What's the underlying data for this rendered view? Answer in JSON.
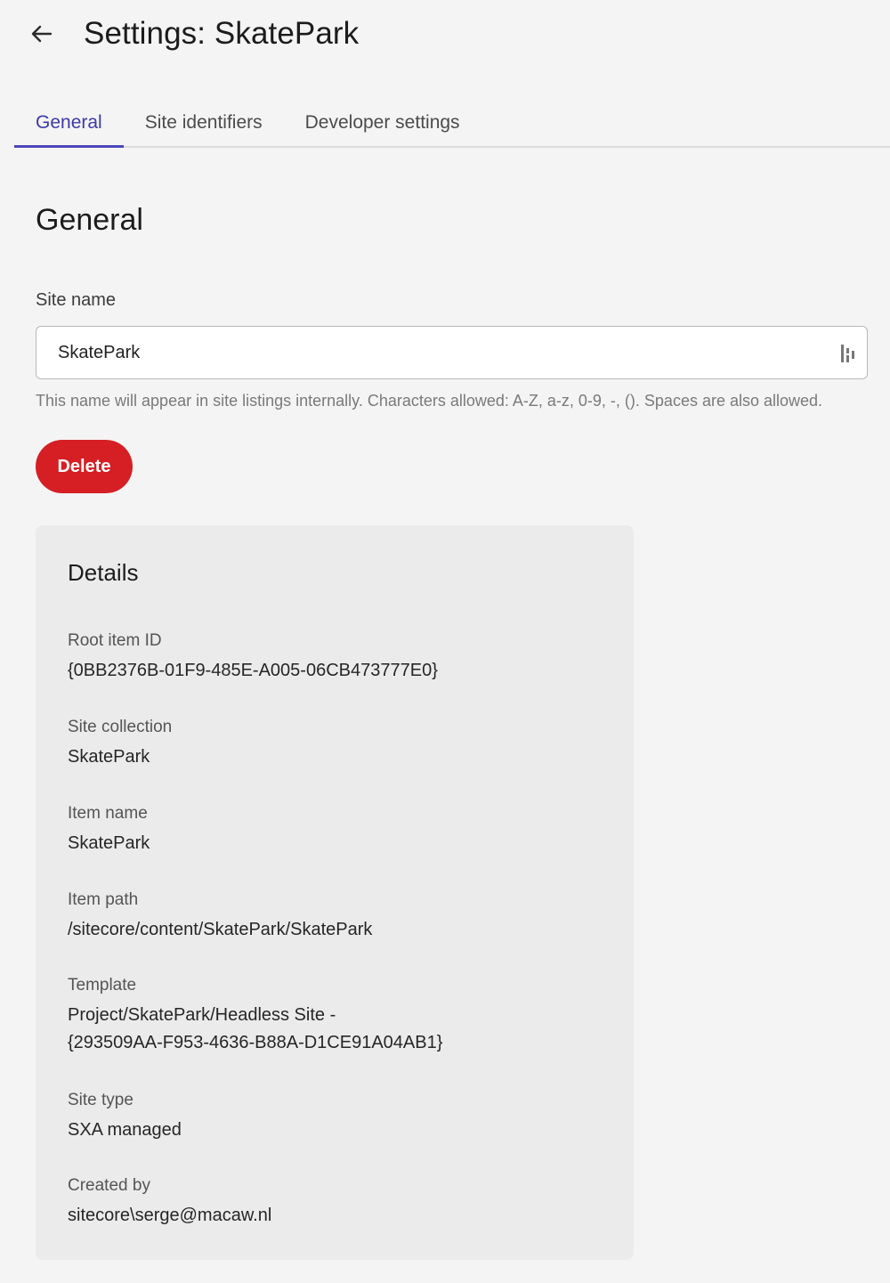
{
  "header": {
    "title": "Settings: SkatePark"
  },
  "tabs": [
    {
      "label": "General",
      "active": true
    },
    {
      "label": "Site identifiers",
      "active": false
    },
    {
      "label": "Developer settings",
      "active": false
    }
  ],
  "general": {
    "title": "General",
    "site_name_label": "Site name",
    "site_name_value": "SkatePark",
    "helper_text": "This name will appear in site listings internally. Characters allowed: A-Z, a-z, 0-9, -, (). Spaces are also allowed.",
    "delete_label": "Delete"
  },
  "details": {
    "title": "Details",
    "items": [
      {
        "label": "Root item ID",
        "value": "{0BB2376B-01F9-485E-A005-06CB473777E0}"
      },
      {
        "label": "Site collection",
        "value": "SkatePark"
      },
      {
        "label": "Item name",
        "value": "SkatePark"
      },
      {
        "label": "Item path",
        "value": "/sitecore/content/SkatePark/SkatePark"
      },
      {
        "label": "Template",
        "value": "Project/SkatePark/Headless Site -\n{293509AA-F953-4636-B88A-D1CE91A04AB1}"
      },
      {
        "label": "Site type",
        "value": "SXA managed"
      },
      {
        "label": "Created by",
        "value": "sitecore\\serge@macaw.nl"
      }
    ]
  },
  "colors": {
    "accent": "#3d3aa8",
    "danger": "#d51f24",
    "background": "#f4f4f4",
    "card": "#ebebeb"
  },
  "icons": {
    "back": "arrow-left-icon",
    "password_manager": "password-manager-icon"
  }
}
